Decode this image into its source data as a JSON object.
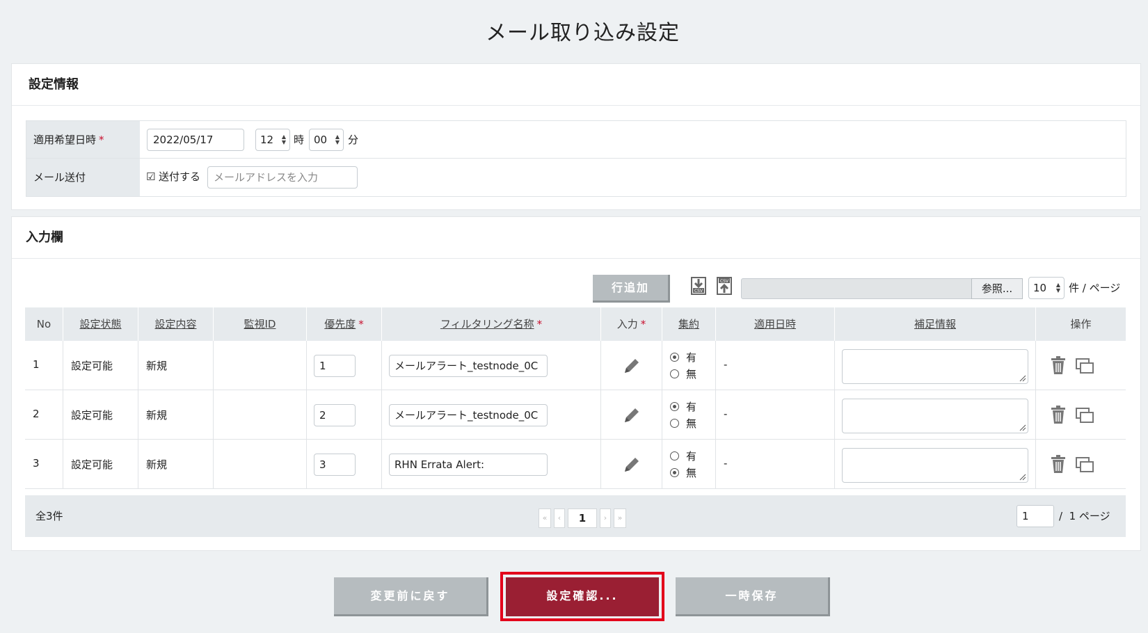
{
  "page": {
    "title": "メール取り込み設定"
  },
  "settings": {
    "heading": "設定情報",
    "date_label": "適用希望日時",
    "required_mark": "*",
    "date_value": "2022/05/17",
    "hour_value": "12",
    "hour_unit": "時",
    "minute_value": "00",
    "minute_unit": "分",
    "mail_label": "メール送付",
    "send_checked": "☑",
    "send_label": "送付する",
    "mail_placeholder": "メールアドレスを入力"
  },
  "input_section": {
    "heading": "入力欄",
    "add_row_label": "行追加",
    "browse_label": "参照...",
    "per_page_value": "10",
    "per_page_unit": "件 / ページ",
    "icons": [
      "csv-download-icon",
      "csv-upload-icon"
    ]
  },
  "table": {
    "columns": {
      "no": "No",
      "status": "設定状態",
      "content": "設定内容",
      "monitor_id": "監視ID",
      "priority": "優先度",
      "filter_name": "フィルタリング名称",
      "input": "入力",
      "aggregate": "集約",
      "apply_date": "適用日時",
      "notes": "補足情報",
      "ops": "操作"
    },
    "required_mark": "*",
    "radio_yes": "有",
    "radio_no": "無",
    "rows": [
      {
        "no": "1",
        "status": "設定可能",
        "content": "新規",
        "monitor_id": "",
        "priority": "1",
        "filter_name": "メールアラート_testnode_0C",
        "aggregate": "有",
        "apply_date": "-",
        "notes": ""
      },
      {
        "no": "2",
        "status": "設定可能",
        "content": "新規",
        "monitor_id": "",
        "priority": "2",
        "filter_name": "メールアラート_testnode_0C",
        "aggregate": "有",
        "apply_date": "-",
        "notes": ""
      },
      {
        "no": "3",
        "status": "設定可能",
        "content": "新規",
        "monitor_id": "",
        "priority": "3",
        "filter_name": "RHN Errata Alert:",
        "aggregate": "無",
        "apply_date": "-",
        "notes": ""
      }
    ],
    "footer": {
      "total": "全3件",
      "current_page": "1",
      "page_input": "1",
      "page_total": "/  1 ページ"
    }
  },
  "actions": {
    "revert_label": "変更前に戻す",
    "confirm_label": "設定確認...",
    "save_label": "一時保存",
    "colors": {
      "confirm": "#9a1f33",
      "highlight": "#e3001b",
      "gray": "#b6bcbf"
    }
  }
}
